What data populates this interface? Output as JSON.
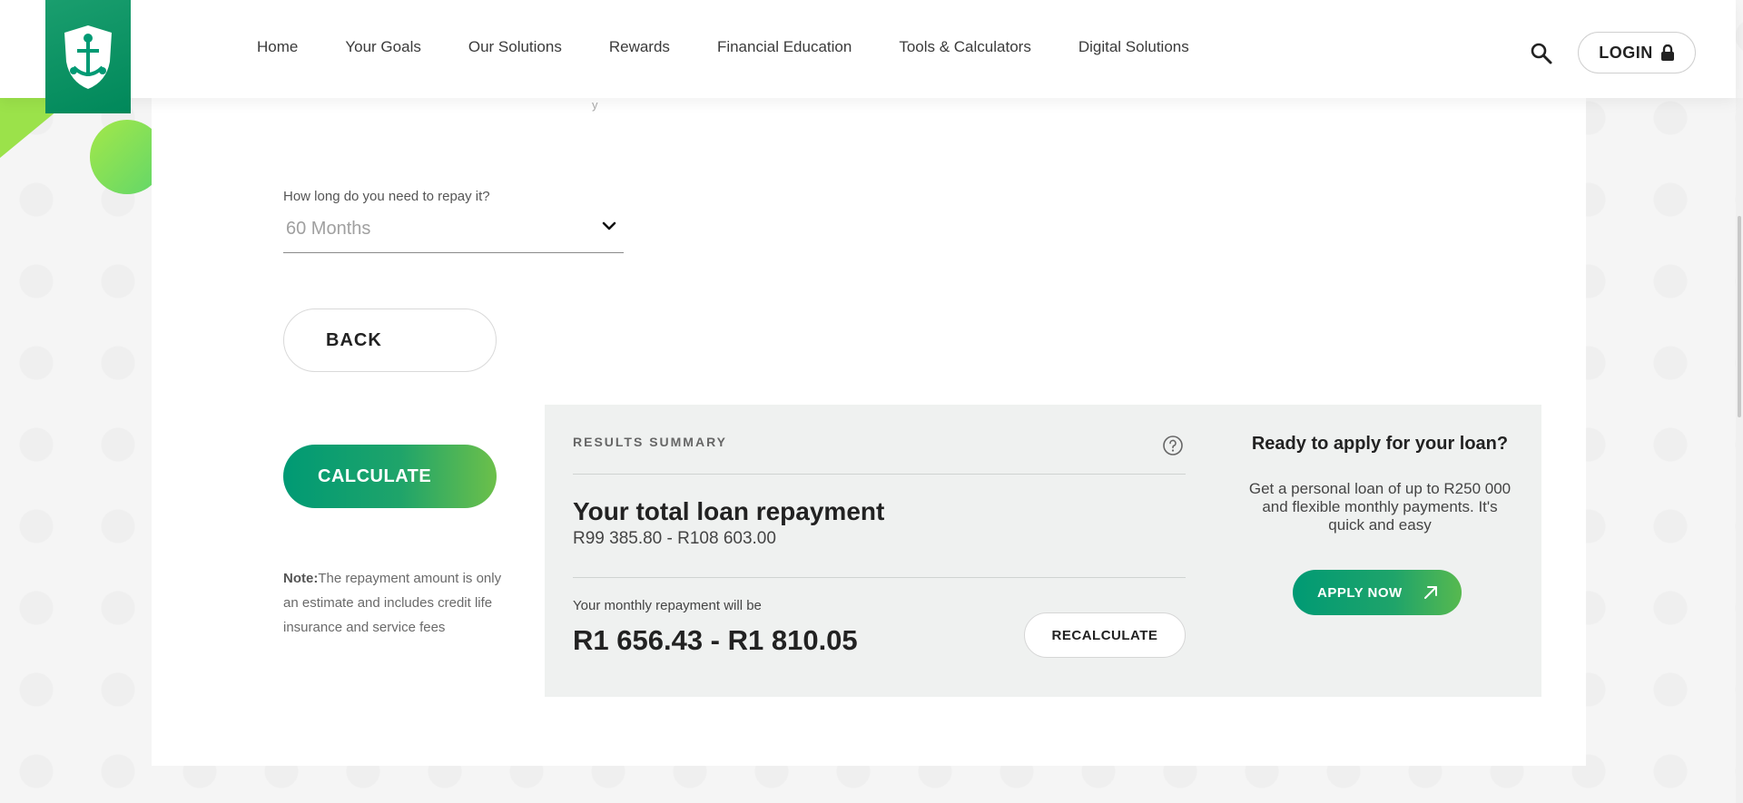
{
  "header": {
    "logo_icon": "anchor-shield-logo",
    "nav": [
      {
        "label": "Home"
      },
      {
        "label": "Your Goals"
      },
      {
        "label": "Our Solutions"
      },
      {
        "label": "Rewards"
      },
      {
        "label": "Financial Education"
      },
      {
        "label": "Tools & Calculators"
      },
      {
        "label": "Digital Solutions"
      }
    ],
    "search_icon": "search-icon",
    "login_label": "LOGIN",
    "login_icon": "lock-icon"
  },
  "calculator": {
    "partial_text": "y",
    "repay_label": "How long do you need to repay it?",
    "repay_value": "60 Months",
    "back_label": "BACK",
    "calculate_label": "CALCULATE",
    "note_prefix": "Note:",
    "note_text": "The repayment amount is only an estimate and includes credit life insurance and service fees"
  },
  "results": {
    "heading": "RESULTS SUMMARY",
    "total_title": "Your total loan repayment",
    "total_range": "R99 385.80 - R108 603.00",
    "monthly_label": "Your monthly repayment will be",
    "monthly_range": "R1 656.43 - R1 810.05",
    "recalculate_label": "RECALCULATE"
  },
  "apply": {
    "title": "Ready to apply for your loan?",
    "text": "Get a personal loan of up to R250 000 and flexible monthly payments. It's quick and easy",
    "button_label": "APPLY NOW"
  },
  "colors": {
    "brand_green": "#009a74",
    "accent_lime": "#6cc04a",
    "panel_bg": "#eff1f0"
  }
}
